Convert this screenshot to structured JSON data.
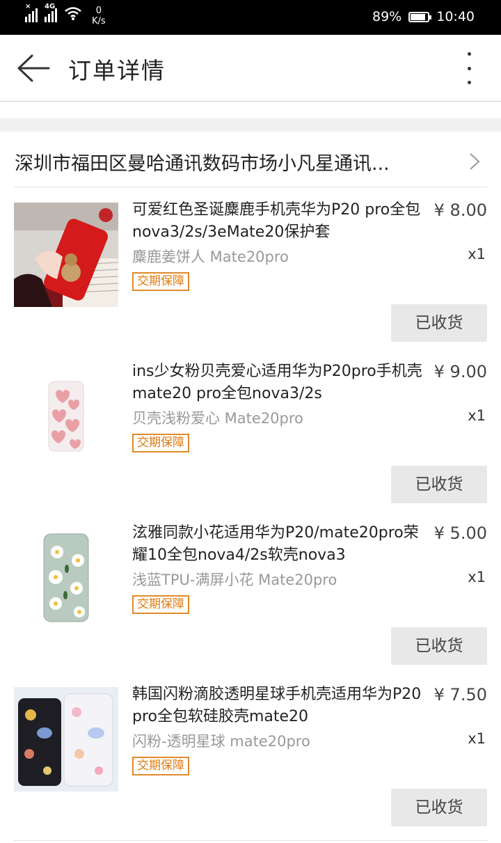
{
  "status_bar": {
    "net_type": "4G",
    "speed_value": "0",
    "speed_unit": "K/s",
    "battery": "89%",
    "time": "10:40"
  },
  "header": {
    "title": "订单详情"
  },
  "shop": {
    "name": "深圳市福田区曼哈通讯数码市场小凡星通讯..."
  },
  "items": [
    {
      "title": "可爱红色圣诞麋鹿手机壳华为P20 pro全包nova3/2s/3eMate20保护套",
      "price": "¥ 8.00",
      "spec": "麋鹿姜饼人 Mate20pro",
      "qty": "x1",
      "badge": "交期保障",
      "button": "已收货"
    },
    {
      "title": "ins少女粉贝壳爱心适用华为P20pro手机壳mate20 pro全包nova3/2s",
      "price": "¥ 9.00",
      "spec": "贝壳浅粉爱心 Mate20pro",
      "qty": "x1",
      "badge": "交期保障",
      "button": "已收货"
    },
    {
      "title": "泫雅同款小花适用华为P20/mate20pro荣耀10全包nova4/2s软壳nova3",
      "price": "¥ 5.00",
      "spec": "浅蓝TPU-满屏小花 Mate20pro",
      "qty": "x1",
      "badge": "交期保障",
      "button": "已收货"
    },
    {
      "title": "韩国闪粉滴胶透明星球手机壳适用华为P20 pro全包软硅胶壳mate20",
      "price": "¥ 7.50",
      "spec": "闪粉-透明星球 mate20pro",
      "qty": "x1",
      "badge": "交期保障",
      "button": "已收货"
    }
  ]
}
